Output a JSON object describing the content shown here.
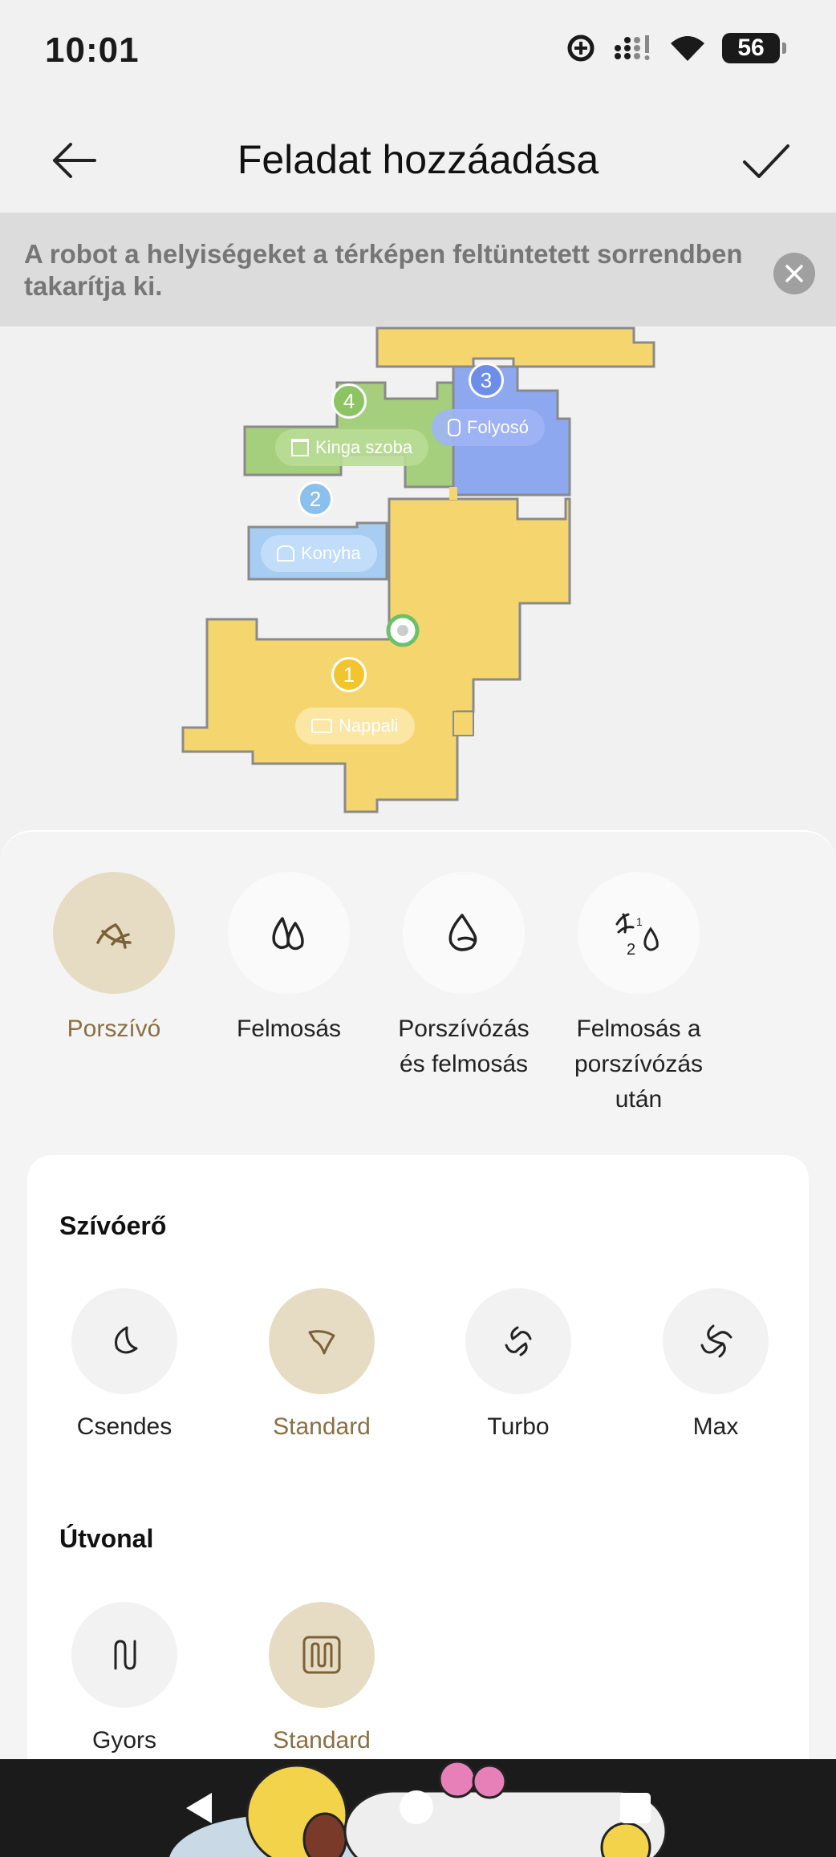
{
  "status_bar": {
    "time": "10:01",
    "battery": "56"
  },
  "header": {
    "title": "Feladat hozzáadása"
  },
  "banner": {
    "text": "A robot a helyiségeket a térképen feltüntetett sorrendben takarítja ki."
  },
  "map": {
    "rooms": [
      {
        "number": "1",
        "name": "Nappali",
        "color": "#f5d66e"
      },
      {
        "number": "2",
        "name": "Konyha",
        "color": "#a7cdf2"
      },
      {
        "number": "3",
        "name": "Folyosó",
        "color": "#8ea8ef"
      },
      {
        "number": "4",
        "name": "Kinga szoba",
        "color": "#a5cf7c"
      }
    ]
  },
  "modes": [
    {
      "label": "Porszívó",
      "icon": "vacuum-icon",
      "selected": true
    },
    {
      "label": "Felmosás",
      "icon": "mop-drop-icon",
      "selected": false
    },
    {
      "label": "Porszívózás és felmosás",
      "icon": "vacuum-and-mop-icon",
      "selected": false
    },
    {
      "label": "Felmosás a porszívózás után",
      "icon": "mop-after-vacuum-icon",
      "selected": false
    }
  ],
  "suction": {
    "title": "Szívóerő",
    "options": [
      {
        "label": "Csendes",
        "icon": "quiet-fan-icon",
        "selected": false
      },
      {
        "label": "Standard",
        "icon": "standard-fan-icon",
        "selected": true
      },
      {
        "label": "Turbo",
        "icon": "turbo-fan-icon",
        "selected": false
      },
      {
        "label": "Max",
        "icon": "max-fan-icon",
        "selected": false
      }
    ]
  },
  "route": {
    "title": "Útvonal",
    "options": [
      {
        "label": "Gyors",
        "icon": "quick-route-icon",
        "selected": false
      },
      {
        "label": "Standard",
        "icon": "standard-route-icon",
        "selected": true
      }
    ]
  },
  "colors": {
    "accent": "#8a6f42",
    "accent_bg": "#e6dcc4"
  }
}
